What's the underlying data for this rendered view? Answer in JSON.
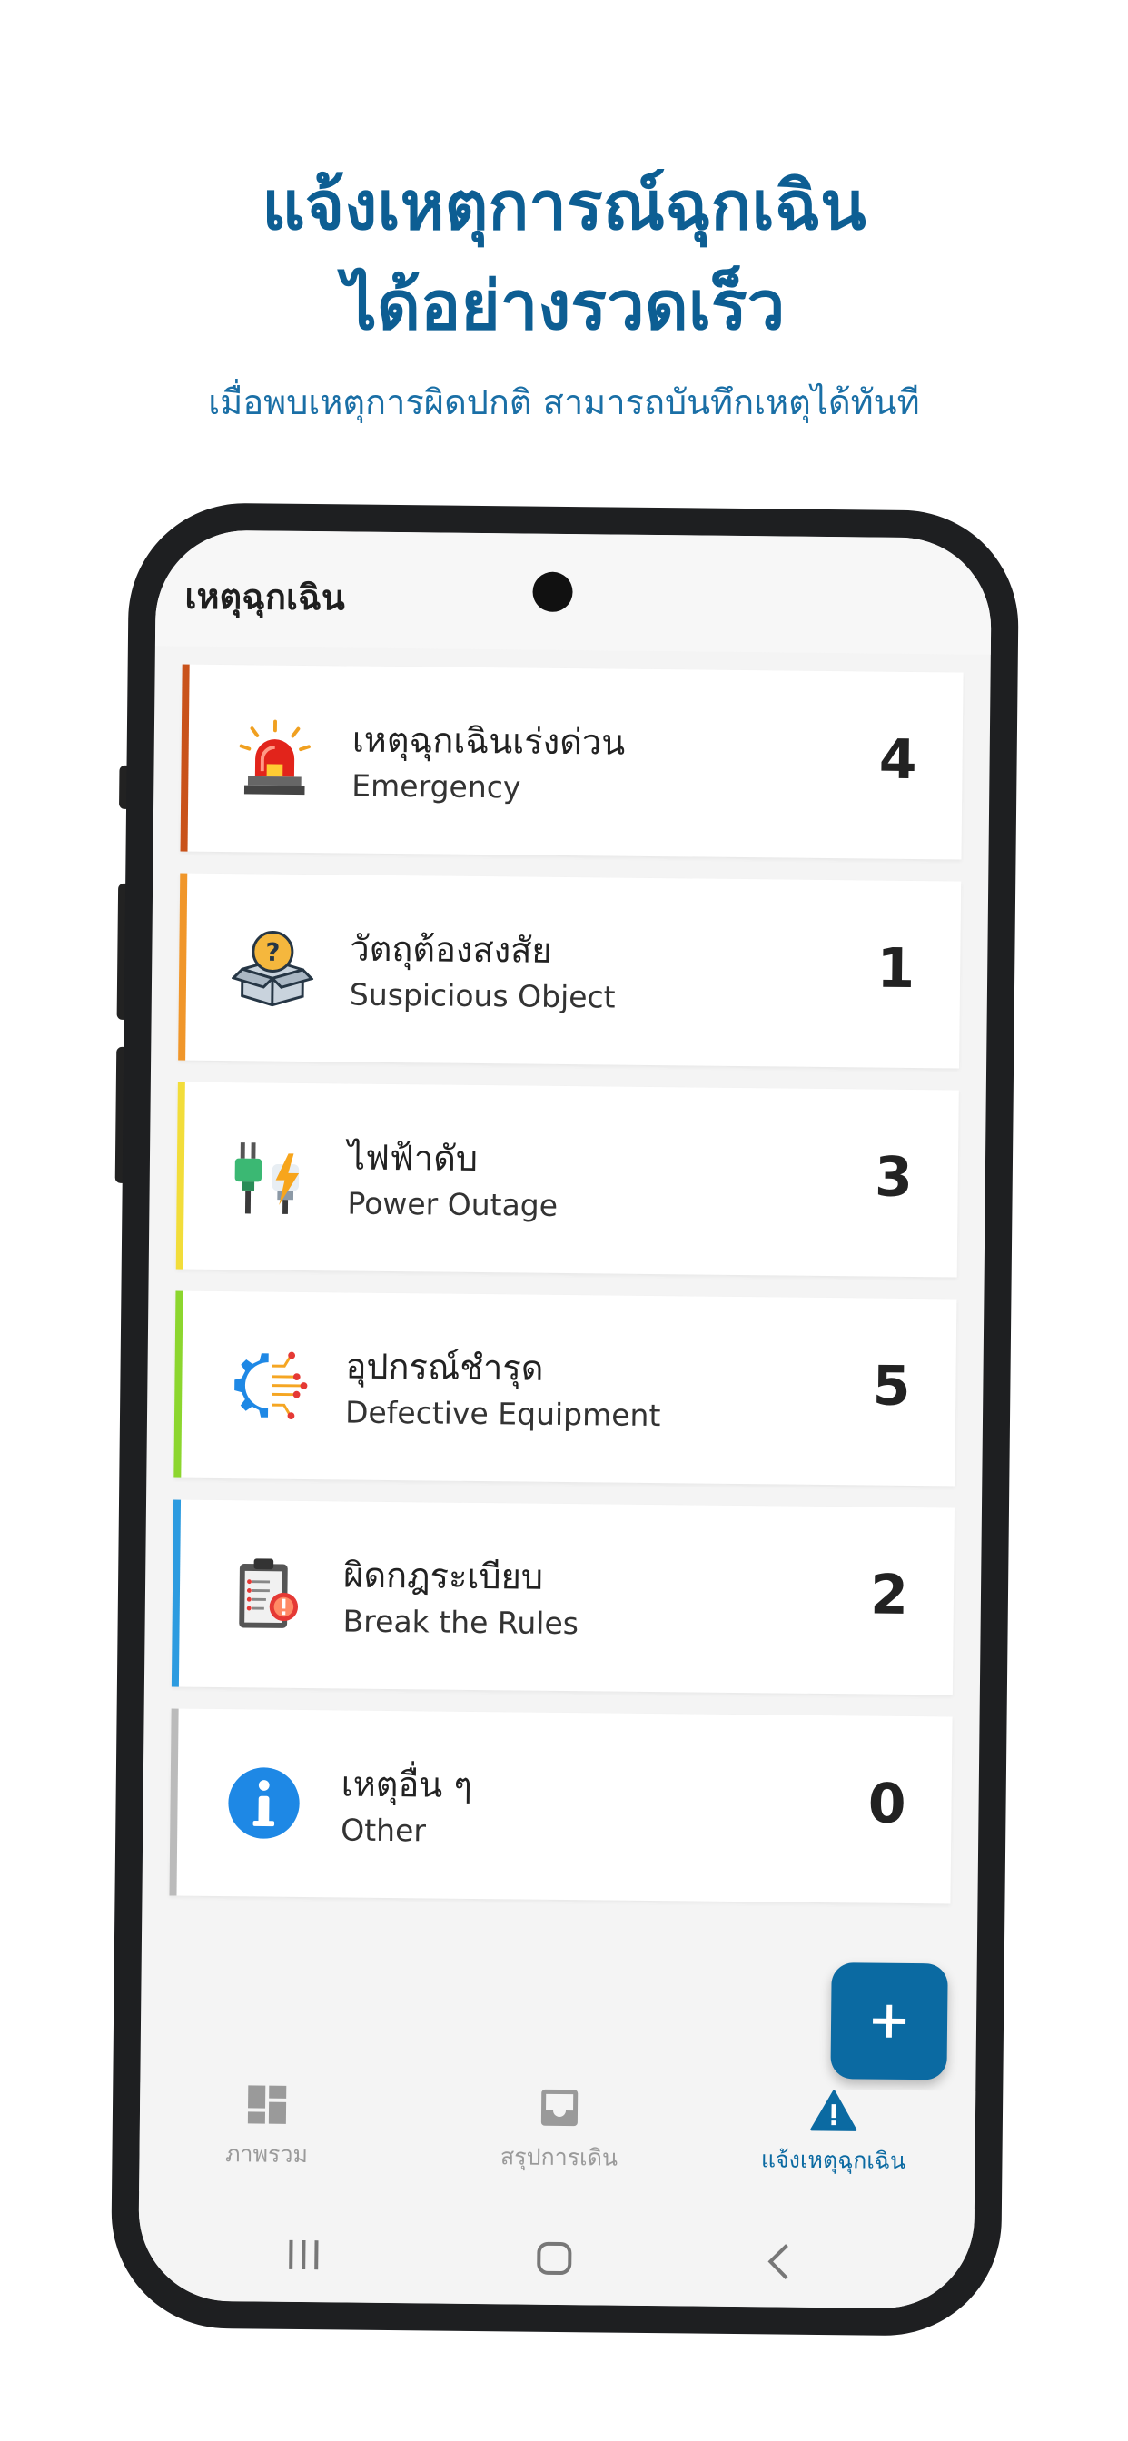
{
  "promo": {
    "title_line1": "แจ้งเหตุการณ์ฉุกเฉิน",
    "title_line2": "ได้อย่างรวดเร็ว",
    "subtitle": "เมื่อพบเหตุการผิดปกติ สามารถบันทึกเหตุได้ทันที"
  },
  "app": {
    "title": "เหตุฉุกเฉิน",
    "categories": [
      {
        "th": "เหตุฉุกเฉินเร่งด่วน",
        "en": "Emergency",
        "count": "4",
        "color": "#c9521a",
        "icon": "siren-icon"
      },
      {
        "th": "วัตถุต้องสงสัย",
        "en": "Suspicious Object",
        "count": "1",
        "color": "#f0962a",
        "icon": "question-box-icon"
      },
      {
        "th": "ไฟฟ้าดับ",
        "en": "Power Outage",
        "count": "3",
        "color": "#f2dd3a",
        "icon": "unplugged-icon"
      },
      {
        "th": "อุปกรณ์ชำรุด",
        "en": "Defective Equipment",
        "count": "5",
        "color": "#8cd62e",
        "icon": "gear-circuit-icon"
      },
      {
        "th": "ผิดกฎระเบียบ",
        "en": "Break the Rules",
        "count": "2",
        "color": "#2c9be0",
        "icon": "clipboard-warning-icon"
      },
      {
        "th": "เหตุอื่น ๆ",
        "en": "Other",
        "count": "0",
        "color": "#bbbbbb",
        "icon": "info-icon"
      }
    ],
    "fab": {
      "icon": "plus-icon"
    },
    "nav": [
      {
        "label": "ภาพรวม",
        "icon": "dashboard-icon",
        "active": false
      },
      {
        "label": "สรุปการเดิน",
        "icon": "inbox-icon",
        "active": false
      },
      {
        "label": "แจ้งเหตุฉุกเฉิน",
        "icon": "warning-icon",
        "active": true
      }
    ],
    "colors": {
      "primary": "#0b6aa2",
      "inactive": "#9a9a9a"
    }
  }
}
